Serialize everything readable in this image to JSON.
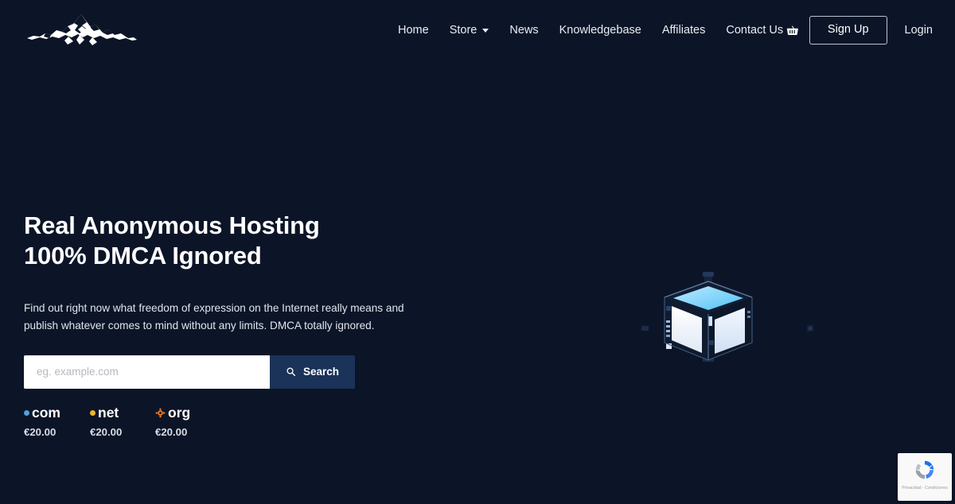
{
  "site": {
    "background_color": "#0c1527",
    "logo_name": "mountain-logo"
  },
  "header": {
    "nav": [
      {
        "label": "Home",
        "has_caret": false
      },
      {
        "label": "Store",
        "has_caret": true
      },
      {
        "label": "News",
        "has_caret": false
      },
      {
        "label": "Knowledgebase",
        "has_caret": false
      },
      {
        "label": "Affiliates",
        "has_caret": false
      },
      {
        "label": "Contact Us",
        "has_caret": false
      }
    ],
    "cart_icon": "basket-icon",
    "signup_label": "Sign Up",
    "login_label": "Login"
  },
  "hero": {
    "headline_line1": "Real Anonymous Hosting",
    "headline_line2": "100% DMCA Ignored",
    "subtitle": "Find out right now what freedom of expression on the Internet really means and publish whatever comes to mind without any limits. DMCA totally ignored.",
    "search": {
      "placeholder": "eg. example.com",
      "value": "",
      "button_label": "Search",
      "button_icon": "search-icon",
      "button_color": "#1b3259"
    },
    "tlds": [
      {
        "name": ".com",
        "label": "com",
        "price": "€20.00",
        "dot_color": "#4aa3df",
        "mark": "dot"
      },
      {
        "name": ".net",
        "label": "net",
        "price": "€20.00",
        "dot_color": "#f0b429",
        "mark": "dot"
      },
      {
        "name": ".org",
        "label": "org",
        "price": "€20.00",
        "dot_color": "#ef7622",
        "mark": "org"
      }
    ],
    "artwork": "glowing-server-cube-illustration"
  },
  "recaptcha": {
    "text": "Privacidad - Condiciones",
    "icon": "recaptcha-icon"
  }
}
